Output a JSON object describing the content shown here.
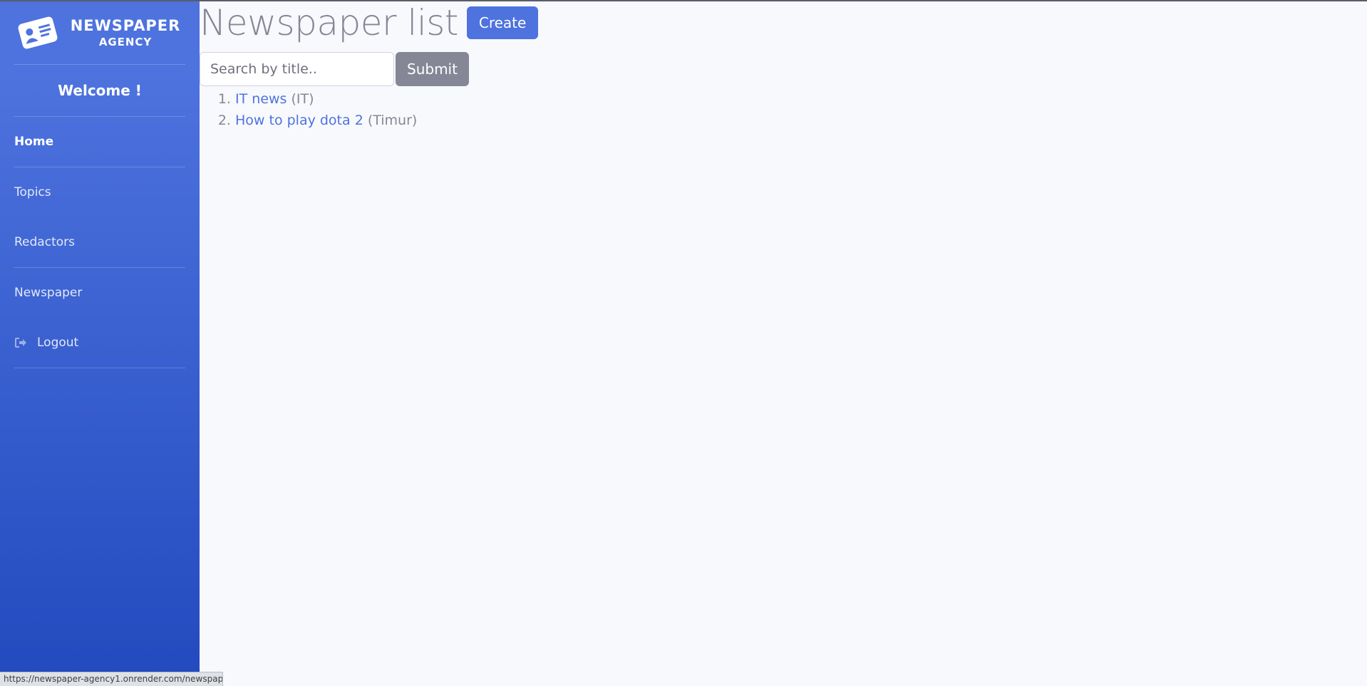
{
  "sidebar": {
    "brand": {
      "line1": "NEWSPAPER",
      "line2": "AGENCY",
      "icon": "id-card-icon"
    },
    "welcome": "Welcome !",
    "items": [
      {
        "label": "Home"
      },
      {
        "label": "Topics"
      },
      {
        "label": "Redactors"
      },
      {
        "label": "Newspaper"
      },
      {
        "label": "Logout",
        "icon": "sign-out-icon"
      }
    ]
  },
  "main": {
    "title": "Newspaper list",
    "create_label": "Create",
    "search": {
      "placeholder": "Search by title..",
      "value": ""
    },
    "submit_label": "Submit",
    "newspapers": [
      {
        "title": "IT news",
        "topic": "(IT)"
      },
      {
        "title": "How to play dota 2",
        "topic": "(Timur)"
      }
    ]
  },
  "status_url": "https://newspaper-agency1.onrender.com/newspapers/#",
  "colors": {
    "primary": "#4e73df",
    "secondary": "#858796",
    "background": "#f8f9fc"
  }
}
